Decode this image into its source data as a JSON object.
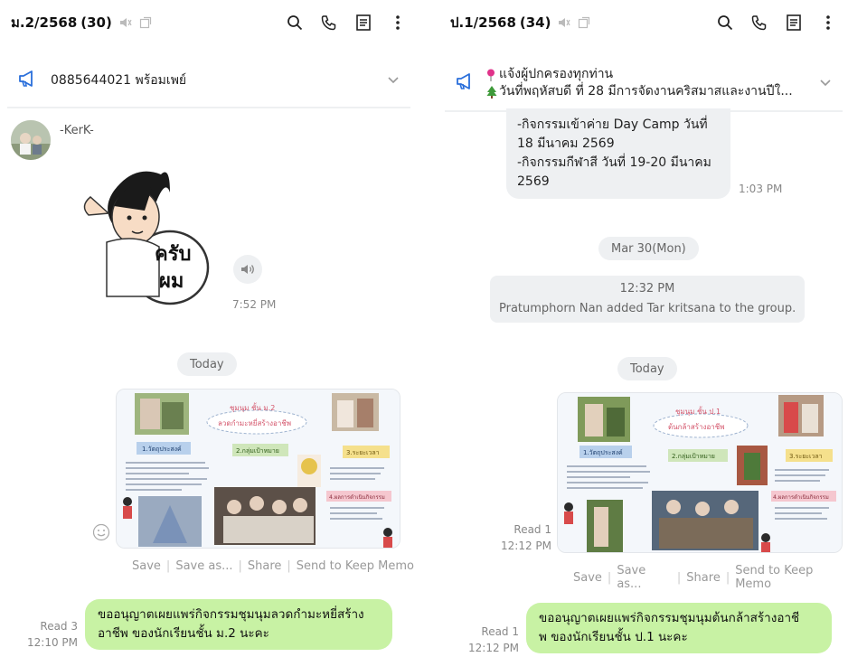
{
  "left": {
    "header": {
      "title": "ม.2/2568",
      "count": "(30)"
    },
    "announcement": {
      "text": "0885644021 พร้อมเพย์"
    },
    "sender": {
      "name": "-KerK-"
    },
    "sticker": {
      "text_line1": "ครับ",
      "text_line2": "ผม",
      "time": "7:52 PM"
    },
    "date_divider": "Today",
    "image": {
      "title": "ชุมนุม ชั้น ม.2",
      "subtitle": "ลวดกำมะหยี่สร้างอาชีพ",
      "box1": "1.วัตถุประสงค์",
      "box2": "2.กลุ่มเป้าหมาย",
      "box3": "3.ระยะเวลา",
      "box4": "4.ผลการดำเนินกิจกรรม"
    },
    "image_actions": [
      "Save",
      "Save as...",
      "Share",
      "Send to Keep Memo"
    ],
    "message": {
      "read": "Read 3",
      "time": "12:10 PM",
      "line1": "ขออนุญาตเผยแพร่กิจกรรมชุมนุมลวดกำมะหยี่สร้าง",
      "line2": "อาชีพ ของนักเรียนชั้น ม.2 นะคะ"
    }
  },
  "right": {
    "header": {
      "title": "ป.1/2568",
      "count": "(34)"
    },
    "announcement": {
      "line1": "แจ้งผู้ปกครองทุกท่าน",
      "line2": "วันที่พฤหัสบดี ที่ 28 มีการจัดงานคริสมาสและงานปีใ..."
    },
    "prev_message": {
      "line1": "-กิจกรรมเข้าค่าย Day Camp วันที่",
      "line2": "18 มีนาคม 2569",
      "line3": "-กิจกรรมกีฬาสี วันที่ 19-20 มีนาคม",
      "line4": "2569",
      "time": "1:03 PM"
    },
    "date_divider_1": "Mar 30(Mon)",
    "system": {
      "time": "12:32 PM",
      "text": "Pratumphorn  Nan added Tar kritsana to the group."
    },
    "date_divider_2": "Today",
    "image": {
      "title": "ชุมนุม ชั้น ป.1",
      "subtitle": "ต้นกล้าสร้างอาชีพ",
      "box1": "1.วัตถุประสงค์",
      "box2": "2.กลุ่มเป้าหมาย",
      "box3": "3.ระยะเวลา",
      "box4": "4.ผลการดำเนินกิจกรรม",
      "read": "Read 1",
      "time": "12:12 PM"
    },
    "image_actions": [
      "Save",
      "Save as...",
      "Share",
      "Send to Keep Memo"
    ],
    "message": {
      "read": "Read 1",
      "time": "12:12 PM",
      "line1": "ขออนุญาตเผยแพร่กิจกรรมชุมนุมต้นกล้าสร้างอาชี",
      "line2": "พ ของนักเรียนชั้น ป.1 นะคะ"
    }
  },
  "colors": {
    "accent_blue": "#2a6fdb",
    "bubble_green": "#c8f2a4",
    "bubble_gray": "#eef0f2"
  },
  "icons": [
    "megaphone-icon",
    "mute-icon",
    "popout-icon",
    "search-icon",
    "phone-icon",
    "notes-icon",
    "more-icon",
    "chevron-down-icon",
    "speaker-icon",
    "emoji-icon",
    "pin-icon",
    "tree-icon"
  ]
}
